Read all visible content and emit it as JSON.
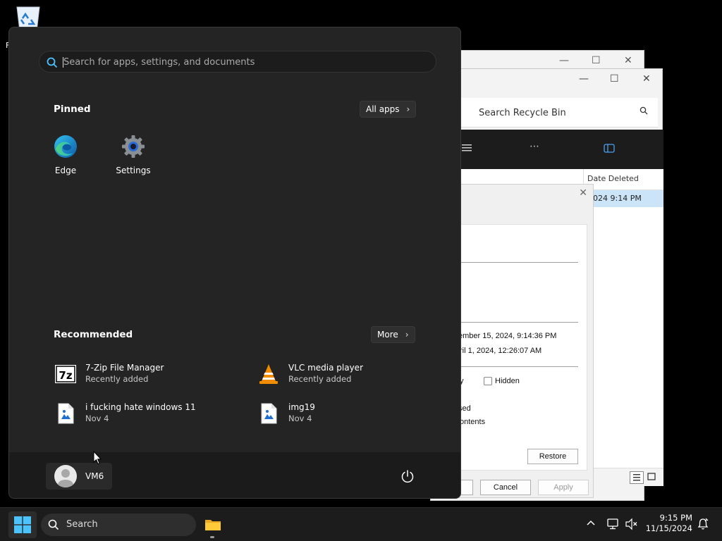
{
  "desktop": {
    "recycle_bin_label_fragment": "F"
  },
  "recycle_bin_window": {
    "search_placeholder": "Search Recycle Bin",
    "column_date_deleted": "Date Deleted",
    "row_date_deleted": "024 9:14 PM"
  },
  "properties_dialog": {
    "created_fragment": "ember 15, 2024, 9:14:36 PM",
    "modified_fragment": "ril 1, 2024, 12:26:07 AM",
    "attr_fragment": "y",
    "hidden_label": "Hidden",
    "compress_fragment": "sed",
    "encrypt_fragment": "ontents",
    "restore_label": "Restore",
    "cancel_label": "Cancel",
    "apply_label": "Apply"
  },
  "start_menu": {
    "search_placeholder": "Search for apps, settings, and documents",
    "pinned_title": "Pinned",
    "all_apps_label": "All apps",
    "pinned_apps": [
      {
        "name": "Edge",
        "icon": "edge-icon"
      },
      {
        "name": "Settings",
        "icon": "settings-gear-icon"
      }
    ],
    "recommended_title": "Recommended",
    "more_label": "More",
    "recommended": [
      {
        "name": "7-Zip File Manager",
        "sub": "Recently added",
        "icon": "7zip-icon"
      },
      {
        "name": "VLC media player",
        "sub": "Recently added",
        "icon": "vlc-icon"
      },
      {
        "name": "i fucking hate windows 11",
        "sub": "Nov 4",
        "icon": "image-file-icon"
      },
      {
        "name": "img19",
        "sub": "Nov 4",
        "icon": "image-file-icon"
      }
    ],
    "user_name": "VM6"
  },
  "taskbar": {
    "search_label": "Search",
    "time": "9:15 PM",
    "date": "11/15/2024"
  },
  "colors": {
    "accent": "#0078d4",
    "start_bg": "#242424",
    "taskbar_bg": "#1c1c1c"
  }
}
